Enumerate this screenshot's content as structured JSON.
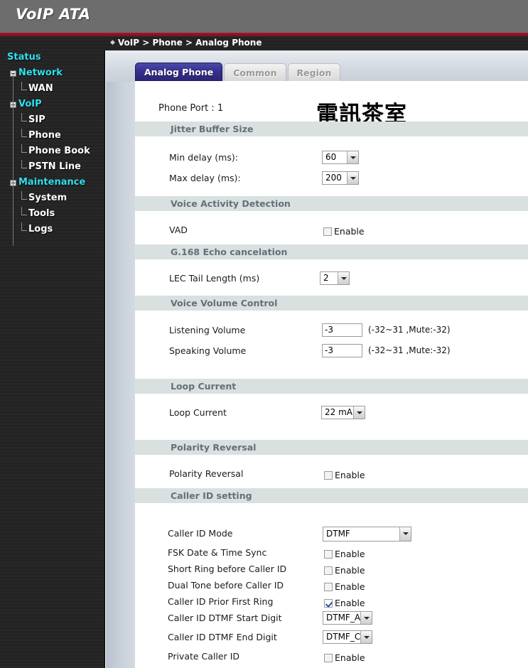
{
  "banner": {
    "title": "VoIP ATA"
  },
  "breadcrumb": {
    "diamond": "◆",
    "text": "VoIP > Phone > Analog Phone"
  },
  "sidebar": {
    "items": [
      {
        "label": "Status",
        "level": 0,
        "expander": false
      },
      {
        "label": "Network",
        "level": 1,
        "expander": true
      },
      {
        "label": "WAN",
        "level": 2,
        "expander": false
      },
      {
        "label": "VoIP",
        "level": 1,
        "expander": true
      },
      {
        "label": "SIP",
        "level": 2,
        "expander": false
      },
      {
        "label": "Phone",
        "level": 2,
        "expander": false
      },
      {
        "label": "Phone Book",
        "level": 2,
        "expander": false
      },
      {
        "label": "PSTN Line",
        "level": 2,
        "expander": false
      },
      {
        "label": "Maintenance",
        "level": 1,
        "expander": true
      },
      {
        "label": "System",
        "level": 2,
        "expander": false
      },
      {
        "label": "Tools",
        "level": 2,
        "expander": false
      },
      {
        "label": "Logs",
        "level": 2,
        "expander": false
      }
    ]
  },
  "tabs": [
    {
      "label": "Analog Phone",
      "active": true
    },
    {
      "label": "Common",
      "active": false
    },
    {
      "label": "Region",
      "active": false
    }
  ],
  "main": {
    "phone_port": "Phone Port : 1",
    "watermark": "電訊茶室",
    "sections": {
      "jitter": "Jitter Buffer Size",
      "vad": "Voice Activity Detection",
      "echo": "G.168 Echo cancelation",
      "volume": "Voice Volume Control",
      "loop": "Loop Current",
      "polarity": "Polarity Reversal",
      "callerid": "Caller ID setting"
    },
    "fields": {
      "min_delay": {
        "label": "Min delay (ms):",
        "value": "60"
      },
      "max_delay": {
        "label": "Max delay (ms):",
        "value": "200"
      },
      "vad": {
        "label": "VAD",
        "checkbox": "Enable",
        "checked": false
      },
      "lec_tail": {
        "label": "LEC Tail Length (ms)",
        "value": "2"
      },
      "listening_volume": {
        "label": "Listening Volume",
        "value": "-3",
        "hint": "(-32~31 ,Mute:-32)"
      },
      "speaking_volume": {
        "label": "Speaking Volume",
        "value": "-3",
        "hint": "(-32~31 ,Mute:-32)"
      },
      "loop_current": {
        "label": "Loop Current",
        "value": "22 mA"
      },
      "polarity": {
        "label": "Polarity Reversal",
        "checkbox": "Enable",
        "checked": false
      },
      "cid_mode": {
        "label": "Caller ID Mode",
        "value": "DTMF"
      },
      "fsk_sync": {
        "label": "FSK Date & Time Sync",
        "checkbox": "Enable",
        "checked": false
      },
      "short_ring": {
        "label": "Short Ring before Caller ID",
        "checkbox": "Enable",
        "checked": false
      },
      "dual_tone": {
        "label": "Dual Tone before Caller ID",
        "checkbox": "Enable",
        "checked": false
      },
      "prior_first_ring": {
        "label": "Caller ID Prior First Ring",
        "checkbox": "Enable",
        "checked": true
      },
      "dtmf_start": {
        "label": "Caller ID DTMF Start Digit",
        "value": "DTMF_A"
      },
      "dtmf_end": {
        "label": "Caller ID DTMF End Digit",
        "value": "DTMF_C"
      },
      "private_cid": {
        "label": "Private Caller ID",
        "checkbox": "Enable",
        "checked": false
      }
    }
  },
  "colors": {
    "banner_bg": "#6d6d6d",
    "accent_red": "#8e1026",
    "nav_top_level": "#2fe0ef",
    "tab_active_bg": "#2c2577",
    "section_bg": "#d9e0e0",
    "section_text": "#646f7a",
    "check_blue": "#2a4ea8"
  }
}
